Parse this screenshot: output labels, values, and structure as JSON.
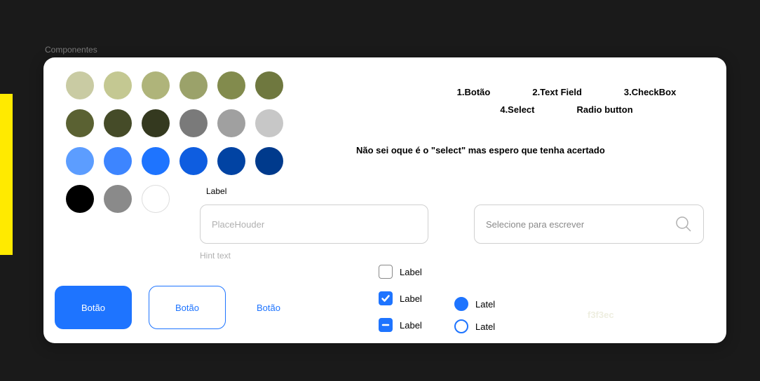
{
  "page_title": "Componentes",
  "palette": {
    "row1": [
      "#c9cba3",
      "#c4c892",
      "#afb47a",
      "#9ba26a",
      "#828b4d",
      "#6f783f"
    ],
    "row2": [
      "#5a6132",
      "#454b28",
      "#34391f",
      "#7a7a7a",
      "#a0a0a0",
      "#c7c7c7"
    ],
    "row3": [
      "#5c9dff",
      "#3d85ff",
      "#1e74ff",
      "#0e5de0",
      "#0143a3",
      "#003a8c"
    ],
    "row4": [
      "#000000",
      "#8a8a8a",
      "#ffffff"
    ],
    "sample_label": "Label"
  },
  "component_list": [
    "1.Botão",
    "2.Text Field",
    "3.CheckBox",
    "4.Select",
    "Radio button"
  ],
  "note": "Não sei oque é o \"select\" mas espero que tenha acertado",
  "textfield": {
    "placeholder": "PlaceHouder",
    "hint": "Hint text"
  },
  "search": {
    "placeholder": "Selecione para escrever"
  },
  "buttons": {
    "primary": "Botão",
    "secondary": "Botão",
    "text": "Botão"
  },
  "checkboxes": [
    {
      "state": "unchecked",
      "label": "Label"
    },
    {
      "state": "checked",
      "label": "Label"
    },
    {
      "state": "indeterminate",
      "label": "Label"
    }
  ],
  "radios": [
    {
      "selected": true,
      "label": "Latel"
    },
    {
      "selected": false,
      "label": "Latel"
    }
  ],
  "ghost_hex": "f3f3ec"
}
